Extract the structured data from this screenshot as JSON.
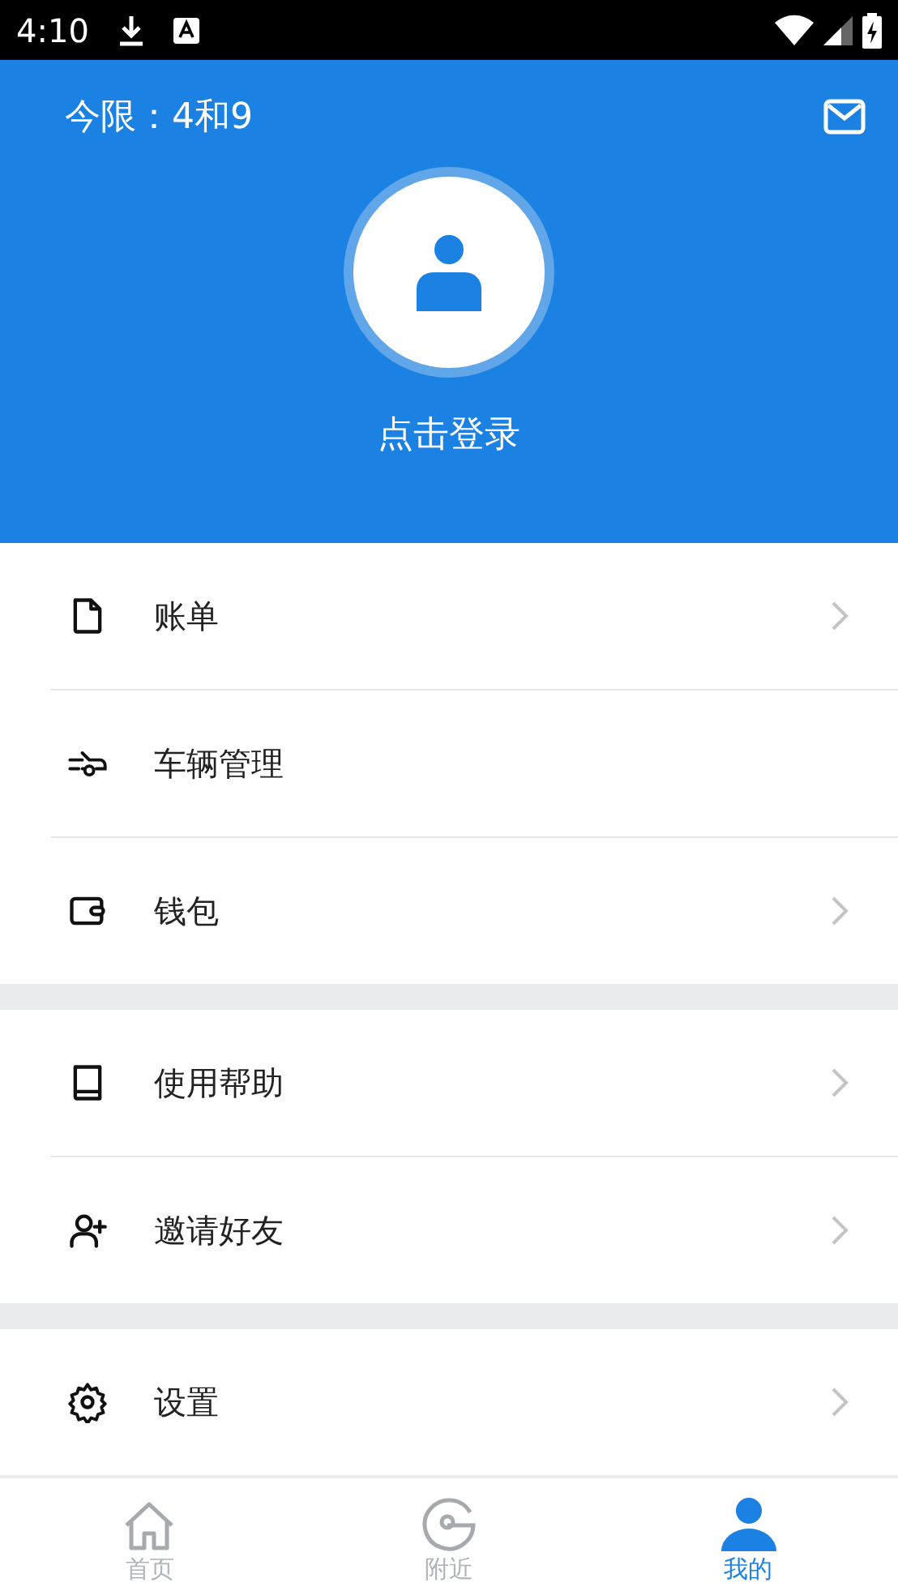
{
  "status_bar": {
    "time": "4:10"
  },
  "header": {
    "restriction": "今限：4和9",
    "login": "点击登录"
  },
  "menu_groups": [
    {
      "items": [
        {
          "label": "账单",
          "chevron": true
        },
        {
          "label": "车辆管理",
          "chevron": false
        },
        {
          "label": "钱包",
          "chevron": true
        }
      ]
    },
    {
      "items": [
        {
          "label": "使用帮助",
          "chevron": true
        },
        {
          "label": "邀请好友",
          "chevron": true
        }
      ]
    },
    {
      "items": [
        {
          "label": "设置",
          "chevron": true
        }
      ]
    }
  ],
  "tab_bar": [
    {
      "label": "首页",
      "selected": false
    },
    {
      "label": "附近",
      "selected": false
    },
    {
      "label": "我的",
      "selected": true
    }
  ]
}
